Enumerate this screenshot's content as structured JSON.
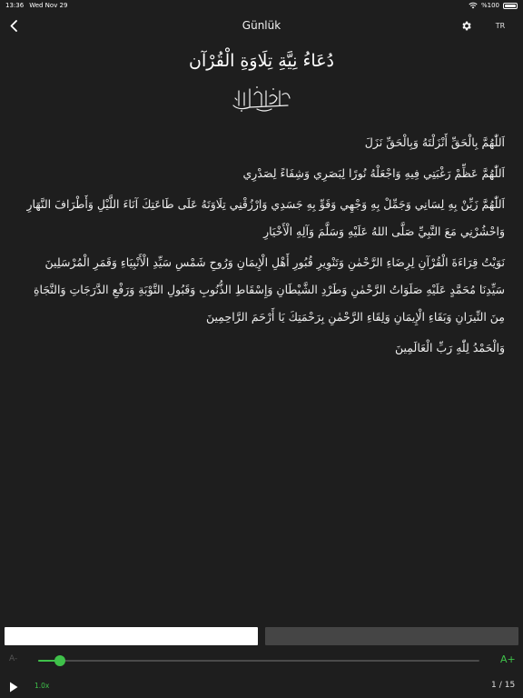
{
  "status_bar": {
    "time": "13:36",
    "date": "Wed Nov 29",
    "battery": "%100"
  },
  "nav": {
    "title": "Günlük",
    "language": "TR",
    "icons": [
      "chevron-left-icon",
      "gear-icon"
    ]
  },
  "content": {
    "title": "دُعَاءُ نِيَّةِ تِلَاوَةِ الْقُرْآن",
    "basmala_icon": "basmala-calligraphy",
    "paragraphs": [
      "اَللّٰهُمَّ بِالْحَقِّ أَنْزَلْتَهُ وَبِالْحَقِّ نَزَلَ",
      "اَللّٰهُمَّ عَظِّمْ رَغْبَتِي فِيهِ وَاجْعَلْهُ نُورًا لِبَصَرِي وَشِفَاءً لِصَدْرِي",
      "اَللّٰهُمَّ زَيِّنْ بِهِ لِسَانِي وَجَمِّلْ بِهِ وَجْهِي وَقَوِّ بِهِ جَسَدِي وَارْزُقْنِي تِلَاوَتَهُ عَلَى طَاعَتِكَ آنَاءَ اللَّيْلِ وَأَطْرَافَ النَّهَارِ وَاحْشُرْنِي مَعَ النَّبِيِّ صَلَّى اللهُ عَلَيْهِ وَسَلَّمَ وَآلِهِ الْأَخْيَارِ",
      "نَوَيْتُ قِرَاءَةَ الْقُرْآنِ لِرِضَاءِ الرَّحْمٰنِ وَتَنْوِيرِ قُبُورِ أَهْلِ الْإِيمَانِ وَرُوحِ شَمْسِ سَيِّدِ الْأَنْبِيَاءِ وَقَمَرِ الْمُرْسَلِينَ سَيِّدِنَا مُحَمَّدٍ عَلَيْهِ صَلَوَاتُ الرَّحْمٰنِ وَطَرْدِ الشَّيْطَانِ وَإِسْقَاطِ الذُّنُوبِ وَقَبُولِ التَّوْبَةِ وَرَفْعِ الدَّرَجَاتِ وَالنَّجَاةِ مِنَ النِّيرَانِ وَبَقَاءِ الْإِيمَانِ وَلِقَاءِ الرَّحْمٰنِ بِرَحْمَتِكَ يَا أَرْحَمَ الرَّاحِمِينَ",
      "وَالْحَمْدُ لِلّٰهِ رَبِّ الْعَالَمِينَ"
    ]
  },
  "controls": {
    "font_decrease": "A-",
    "font_increase": "A+",
    "font_level": 0.05,
    "speed": "1.0x",
    "page_current": "1",
    "page_separator": "/",
    "page_total": "15",
    "accent_color": "#3fc14a",
    "icons": [
      "play-icon"
    ]
  }
}
